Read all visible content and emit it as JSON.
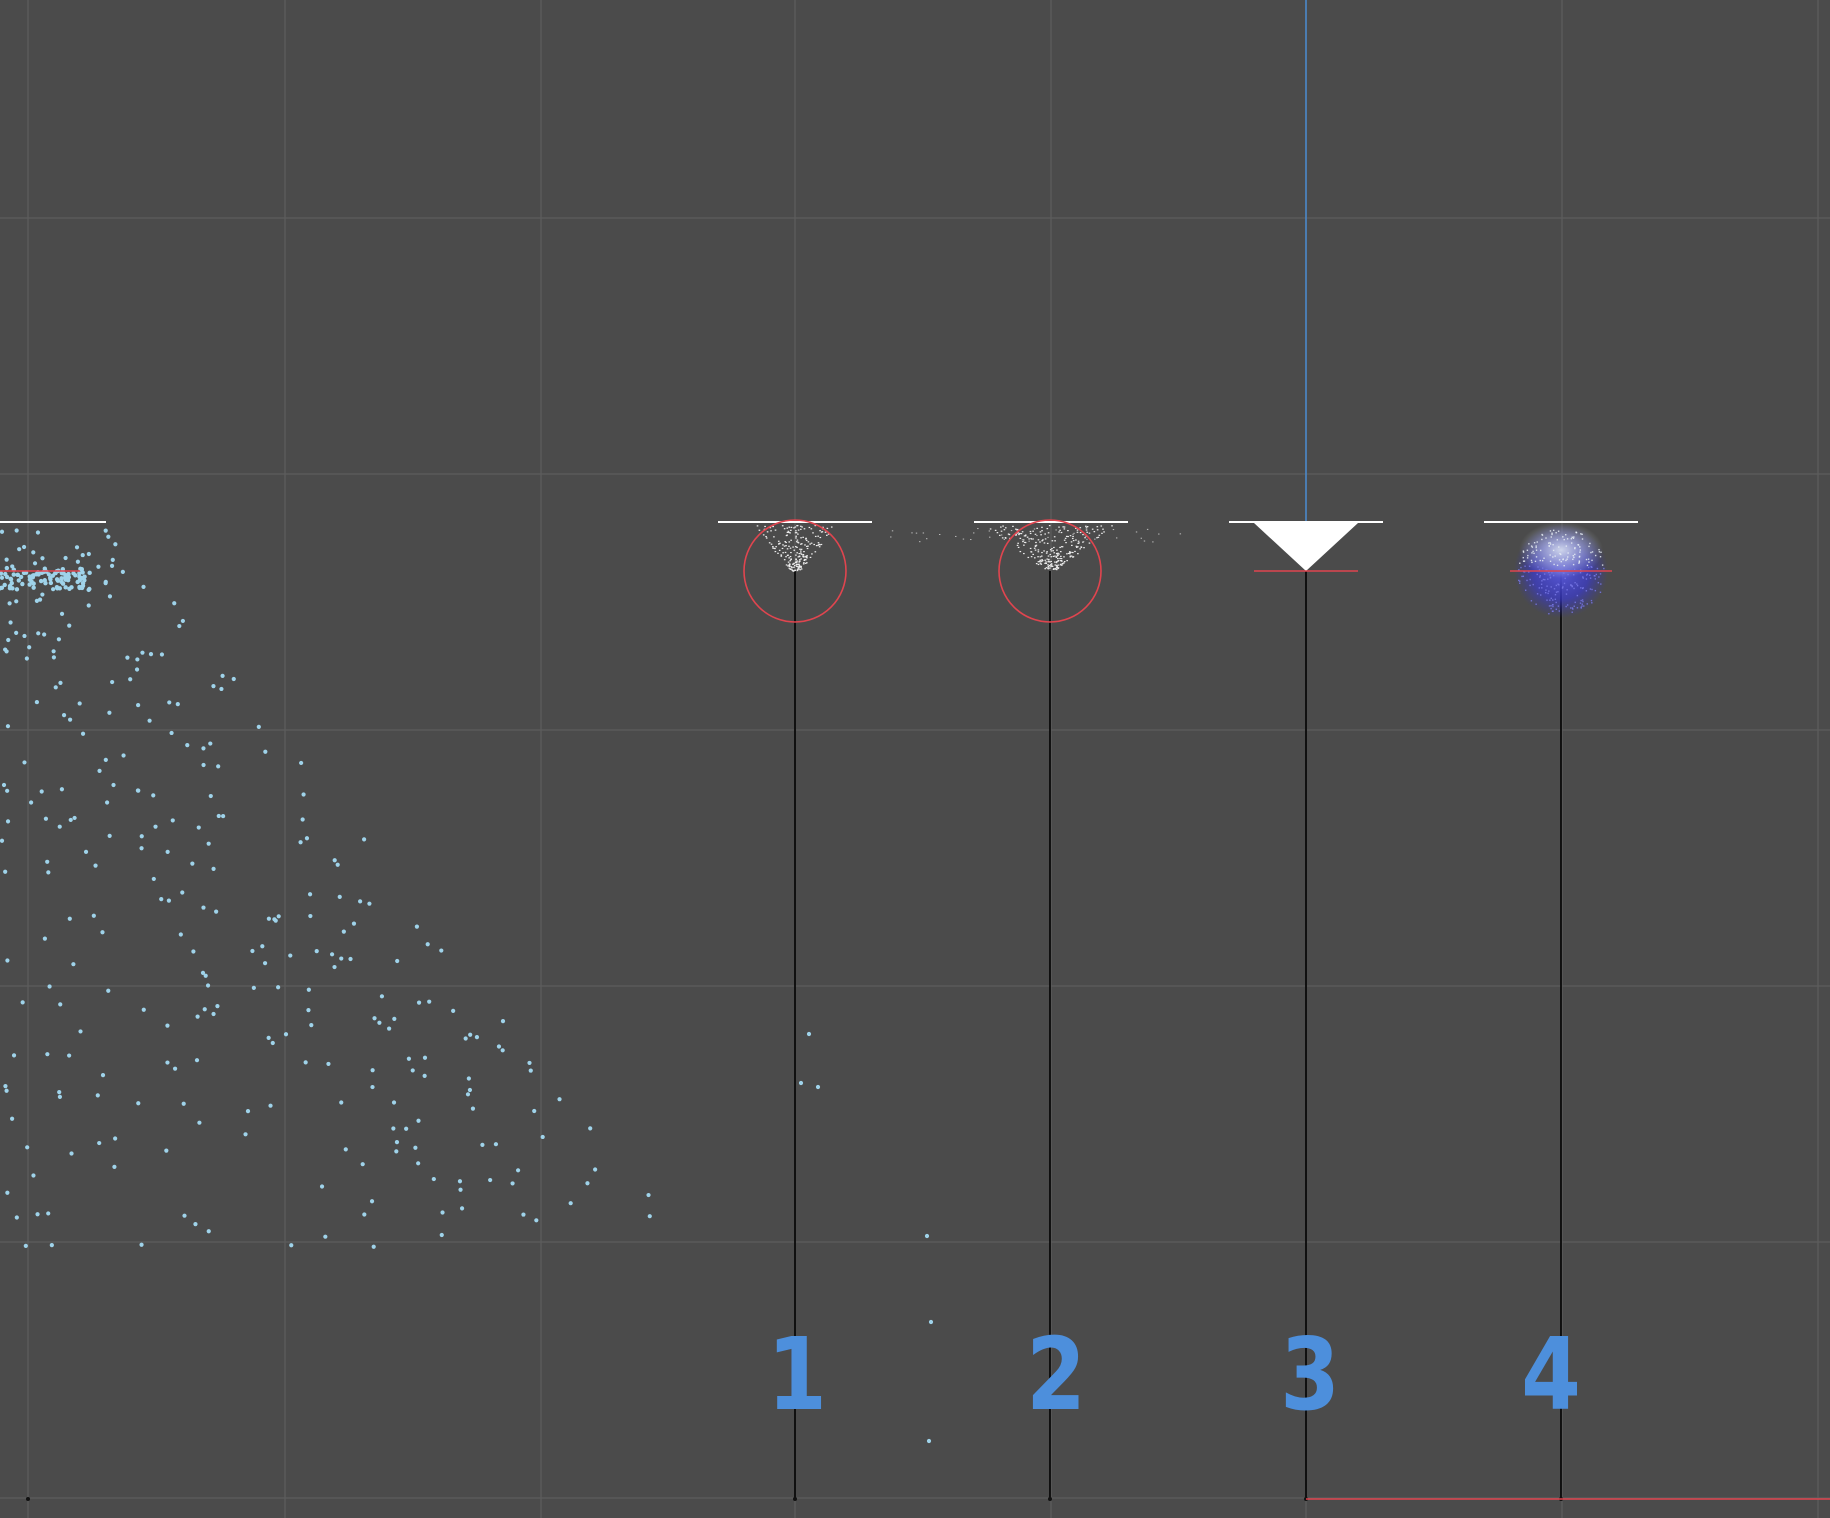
{
  "viewport": {
    "background": "#4b4b4b",
    "grid_color": "#5d5d5d",
    "column_line_color": "#000000",
    "particle_color": "#9fd3ea",
    "label_color": "#4d8fdc",
    "accent_red": "#e0454f",
    "axis_blue": "#4a8bd0"
  },
  "emitters": [
    {
      "id": 1,
      "label": "1",
      "visual": "particle-cluster-with-red-circle"
    },
    {
      "id": 2,
      "label": "2",
      "visual": "wide-particle-cluster-with-red-circle"
    },
    {
      "id": 3,
      "label": "3",
      "visual": "white-inverted-triangle"
    },
    {
      "id": 4,
      "label": "4",
      "visual": "blue-particle-sphere"
    }
  ]
}
